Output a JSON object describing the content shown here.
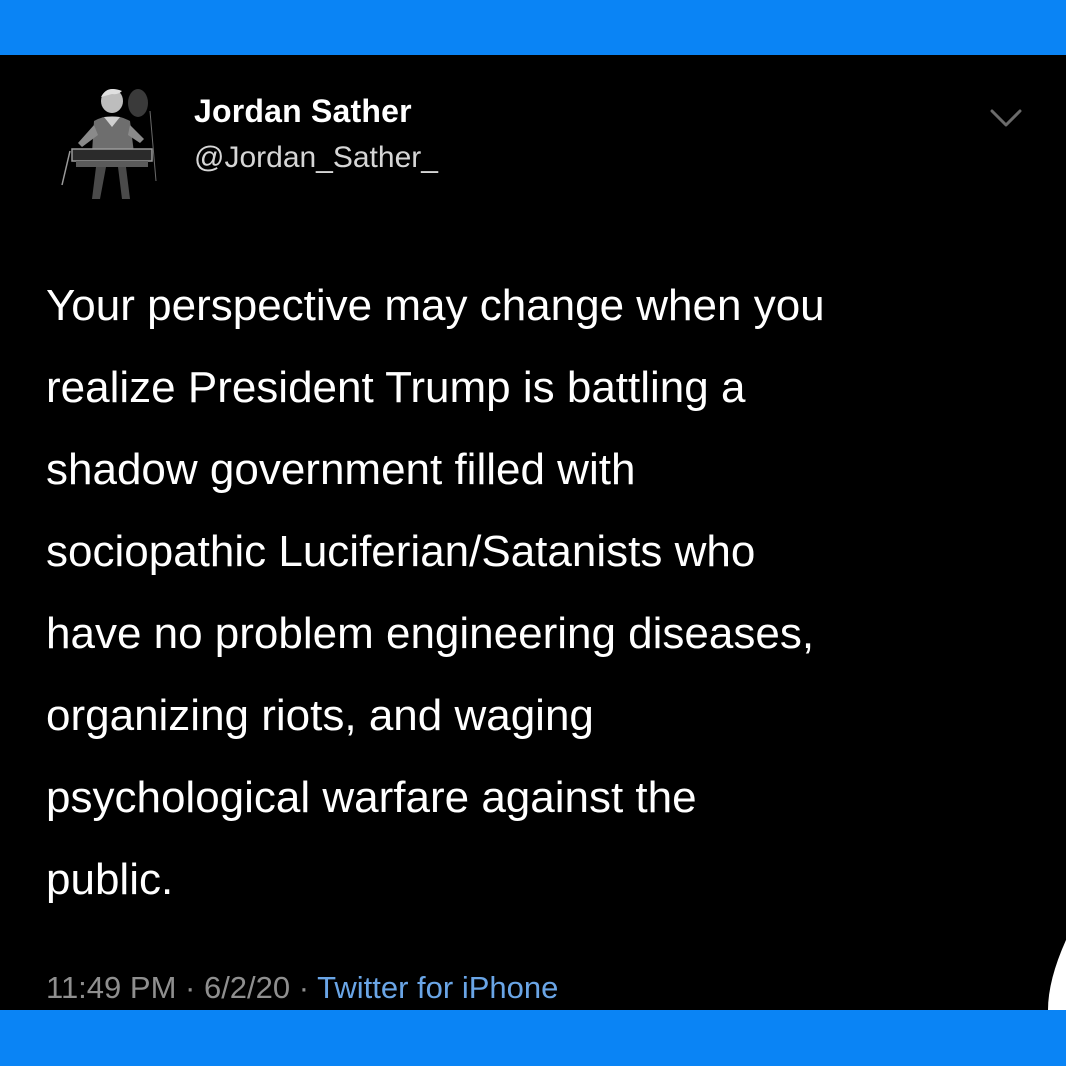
{
  "tweet": {
    "display_name": "Jordan Sather",
    "handle": "@Jordan_Sather_",
    "text": "Your perspective may change when you\nrealize President Trump is battling a\nshadow government filled with\nsociopathic Luciferian/Satanists who\nhave no problem engineering diseases,\norganizing riots, and waging\npsychological warfare against the\npublic.",
    "time": "11:49 PM",
    "separator": " · ",
    "date": "6/2/20",
    "source": "Twitter for iPhone",
    "menu_icon": "chevron-down-icon",
    "avatar_icon": "person-at-podium-photo"
  },
  "colors": {
    "border": "#0a84f5",
    "background": "#000000",
    "text": "#ffffff",
    "secondary": "#8f8f8f",
    "link": "#6aa5e6"
  }
}
